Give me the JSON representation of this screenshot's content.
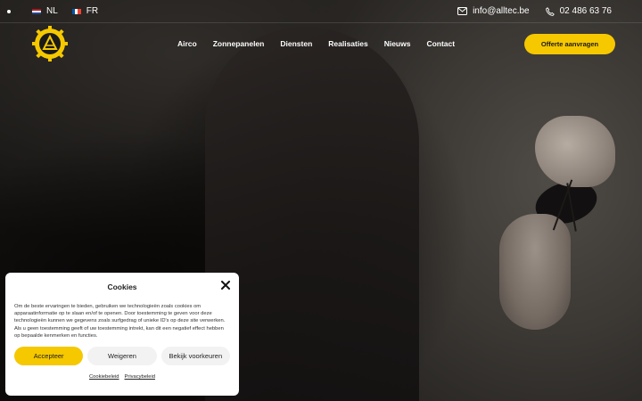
{
  "topbar": {
    "languages": [
      {
        "code": "NL",
        "flag": "flag-netherlands-icon"
      },
      {
        "code": "FR",
        "flag": "flag-france-icon"
      }
    ],
    "email": "info@alltec.be",
    "phone": "02 486 63 76"
  },
  "header": {
    "nav": [
      "Airco",
      "Zonnepanelen",
      "Diensten",
      "Realisaties",
      "Nieuws",
      "Contact"
    ],
    "cta": "Offerte aanvragen"
  },
  "cookie": {
    "title": "Cookies",
    "text": "Om de beste ervaringen te bieden, gebruiken we technologieën zoals cookies om apparaatinformatie op te slaan en/of te openen. Door toestemming te geven voor deze technologieën kunnen we gegevens zoals surfgedrag of unieke ID's op deze site verwerken. Als u geen toestemming geeft of uw toestemming intrekt, kan dit een negatief effect hebben op bepaalde kenmerken en functies.",
    "accept": "Accepteer",
    "deny": "Weigeren",
    "prefs": "Bekijk voorkeuren",
    "links": [
      "Cookiebeleid",
      "Privacybeleid"
    ]
  },
  "colors": {
    "accent": "#f5c800"
  }
}
